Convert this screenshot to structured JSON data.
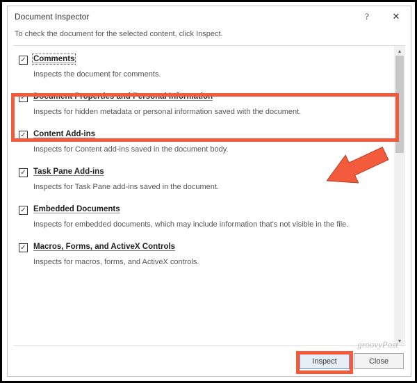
{
  "titlebar": {
    "title": "Document Inspector",
    "help": "?",
    "close": "✕"
  },
  "subtitle": "To check the document for the selected content, click Inspect.",
  "items": [
    {
      "checked": true,
      "title": "Comments",
      "desc": "Inspects the document for comments."
    },
    {
      "checked": true,
      "title": "Document Properties and Personal Information",
      "desc": "Inspects for hidden metadata or personal information saved with the document."
    },
    {
      "checked": true,
      "title": "Content Add-ins",
      "desc": "Inspects for Content add-ins saved in the document body."
    },
    {
      "checked": true,
      "title": "Task Pane Add-ins",
      "desc": "Inspects for Task Pane add-ins saved in the document."
    },
    {
      "checked": true,
      "title": "Embedded Documents",
      "desc": "Inspects for embedded documents, which may include information that's not visible in the file."
    },
    {
      "checked": true,
      "title": "Macros, Forms, and ActiveX Controls",
      "desc": "Inspects for macros, forms, and ActiveX controls."
    }
  ],
  "buttons": {
    "inspect": "Inspect",
    "close": "Close"
  },
  "watermark": "groovyPost"
}
